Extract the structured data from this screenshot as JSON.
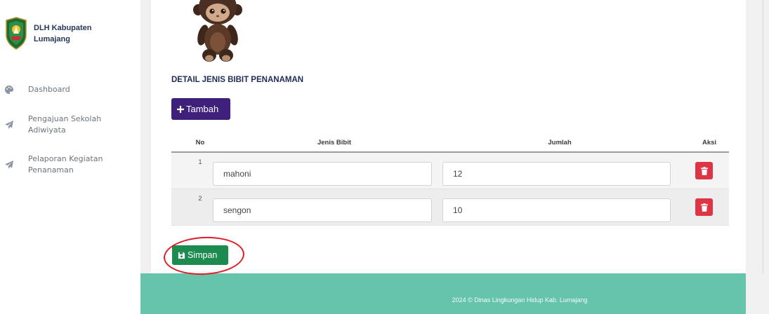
{
  "sidebar": {
    "brand": {
      "name": "DLH Kabupaten Lumajang",
      "logo_icon": "regency-emblem-icon"
    },
    "items": [
      {
        "label": "Dashboard",
        "icon": "palette-icon"
      },
      {
        "label": "Pengajuan Sekolah Adiwiyata",
        "icon": "paper-plane-icon"
      },
      {
        "label": "Pelaporan Kegiatan Penanaman",
        "icon": "paper-plane-icon"
      }
    ]
  },
  "main": {
    "heading": "DETAIL JENIS BIBIT PENANAMAN",
    "add_button": {
      "label": "Tambah",
      "icon": "plus-icon"
    },
    "table": {
      "headers": [
        "No",
        "Jenis Bibit",
        "Jumlah",
        "Aksi"
      ],
      "rows": [
        {
          "no": "1",
          "jenis_bibit": "mahoni",
          "jumlah": "12",
          "action_icon": "trash-icon"
        },
        {
          "no": "2",
          "jenis_bibit": "sengon",
          "jumlah": "10",
          "action_icon": "trash-icon"
        }
      ]
    },
    "save_button": {
      "label": "Simpan",
      "icon": "save-icon"
    }
  },
  "footer": {
    "text": "2024 © Dinas Lingkungan Hidup Kab. Lumajang"
  },
  "colors": {
    "sidebar_text": "#6c757d",
    "brand_text": "#26375a",
    "heading_text": "#1e2b58",
    "add_button": "#3e1f79",
    "save_button": "#1d8a4f",
    "delete_button": "#dc3545",
    "footer_bg": "#66c4ac",
    "annotation_red": "#e31b23"
  }
}
